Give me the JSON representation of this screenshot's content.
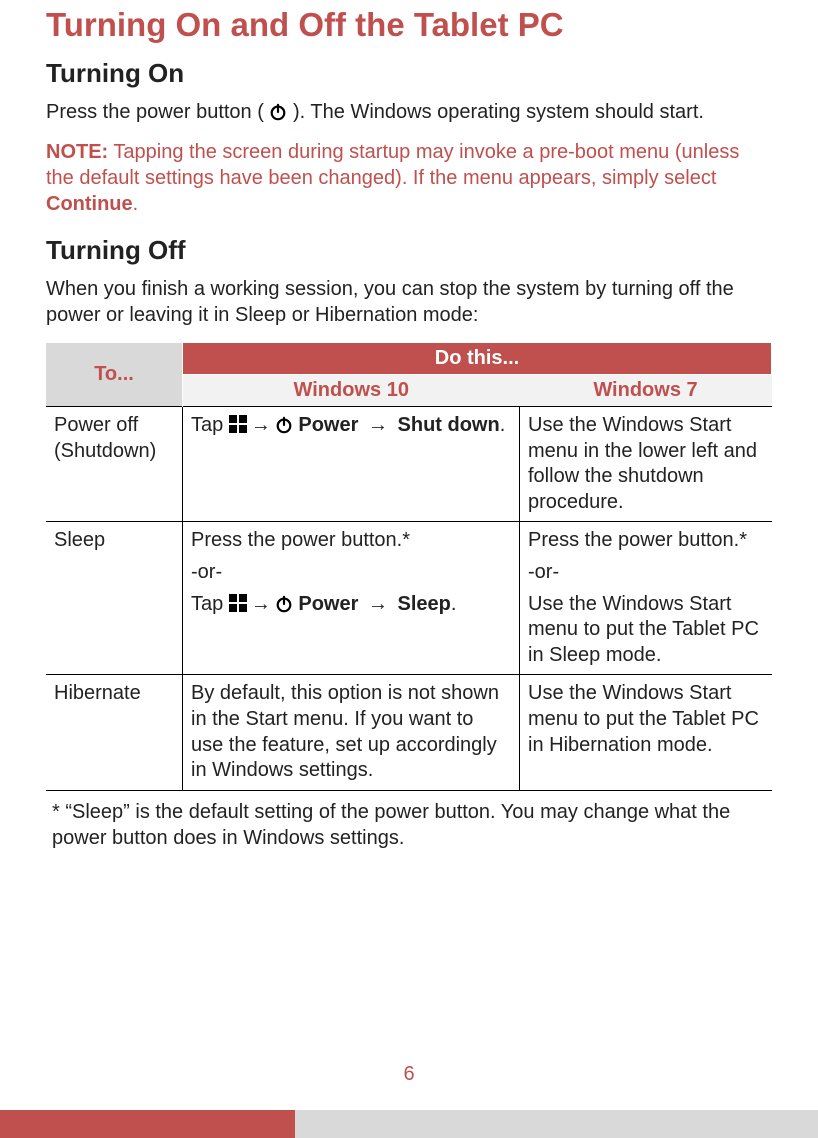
{
  "title": "Turning On and Off the Tablet PC",
  "section_on": {
    "heading": "Turning On",
    "text_before_icon": "Press the power button ( ",
    "text_after_icon": " ). The Windows operating system should start.",
    "note_label": "NOTE:",
    "note_text_1": " Tapping the screen during startup may invoke a pre-boot menu (unless the default settings have been changed). If the menu appears, simply select ",
    "note_continue": "Continue",
    "note_text_2": "."
  },
  "section_off": {
    "heading": "Turning Off",
    "intro": "When you finish a working session, you can stop the system by turning off the power or leaving it in Sleep or Hibernation mode:"
  },
  "table": {
    "hdr_to": "To...",
    "hdr_do": "Do this...",
    "hdr_w10": "Windows 10",
    "hdr_w7": "Windows 7",
    "rows": [
      {
        "to_line1": "Power off",
        "to_line2": "(Shutdown)",
        "w10_tap": "Tap ",
        "w10_power": " Power ",
        "w10_action": " Shut down",
        "w10_period": ".",
        "w7": "Use the Windows Start menu in the lower left and follow the shutdown procedure."
      },
      {
        "to_line1": "Sleep",
        "w10_press": "Press the power button.*",
        "w10_or": "-or-",
        "w10_tap": "Tap ",
        "w10_power": " Power ",
        "w10_action": " Sleep",
        "w10_period": ".",
        "w7_press": "Press the power button.*",
        "w7_or": "-or-",
        "w7_use": "Use the Windows Start menu to put the Tablet PC in Sleep mode."
      },
      {
        "to_line1": "Hibernate",
        "w10": "By default, this option is not shown in the Start menu. If you want to use the feature, set up accordingly in Windows settings.",
        "w7": "Use the Windows Start menu to put the Tablet PC in Hibernation mode."
      }
    ]
  },
  "footnote": "* “Sleep” is the default setting of the power button. You may change what the power button does in Windows settings.",
  "page_number": "6",
  "icons": {
    "power": "power-icon",
    "windows": "windows-logo-icon",
    "arrow": "→"
  }
}
